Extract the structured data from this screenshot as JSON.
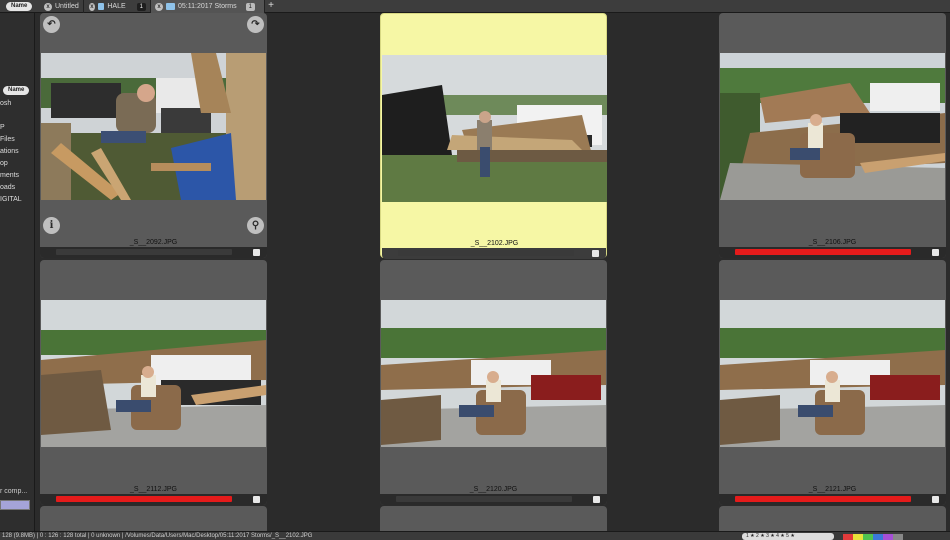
{
  "tabbar": {
    "name_sort_pill": "Name",
    "tabs": [
      {
        "label": "Untitled",
        "close": "x"
      },
      {
        "label": "HALE",
        "close": "x",
        "badge": "1"
      },
      {
        "label": "05:11:2017 Storms",
        "close": "x",
        "badge": "1"
      }
    ],
    "add_label": "+"
  },
  "sidebar": {
    "name_sort_pill": "Name",
    "items": [
      "osh",
      "P",
      "Files",
      "ations",
      "op",
      "ments",
      "oads",
      "IGITAL"
    ],
    "field_label": "r comp..."
  },
  "controls": {
    "rotate_left": "↶",
    "rotate_right": "↷",
    "info": "i",
    "zoom": "⚲"
  },
  "thumbnails": [
    {
      "filename": "_S__2092.JPG",
      "label_color": "none",
      "selected": false
    },
    {
      "filename": "_S__2102.JPG",
      "label_color": "none",
      "selected": true
    },
    {
      "filename": "_S__2106.JPG",
      "label_color": "red",
      "selected": false
    },
    {
      "filename": "_S__2112.JPG",
      "label_color": "red",
      "selected": false
    },
    {
      "filename": "_S__2120.JPG",
      "label_color": "none",
      "selected": false
    },
    {
      "filename": "_S__2121.JPG",
      "label_color": "red",
      "selected": false
    }
  ],
  "status": {
    "left_text": "128 (9.8MB) | 0 : 126 : 128 total | 0 unknown | /Volumes/Data/Users/Mac/Desktop/05:11:2017 Storms/_S__2102.JPG",
    "rating_text": "1 ★ 2 ★ 3 ★ 4 ★ 5 ★",
    "label_colors": [
      "#e23b3b",
      "#e9e23a",
      "#4fc34f",
      "#3b78d8",
      "#a64fd6",
      "#888888"
    ]
  },
  "colors": {
    "accent_select": "#f6f7a5",
    "red_label": "#e51b1b"
  }
}
